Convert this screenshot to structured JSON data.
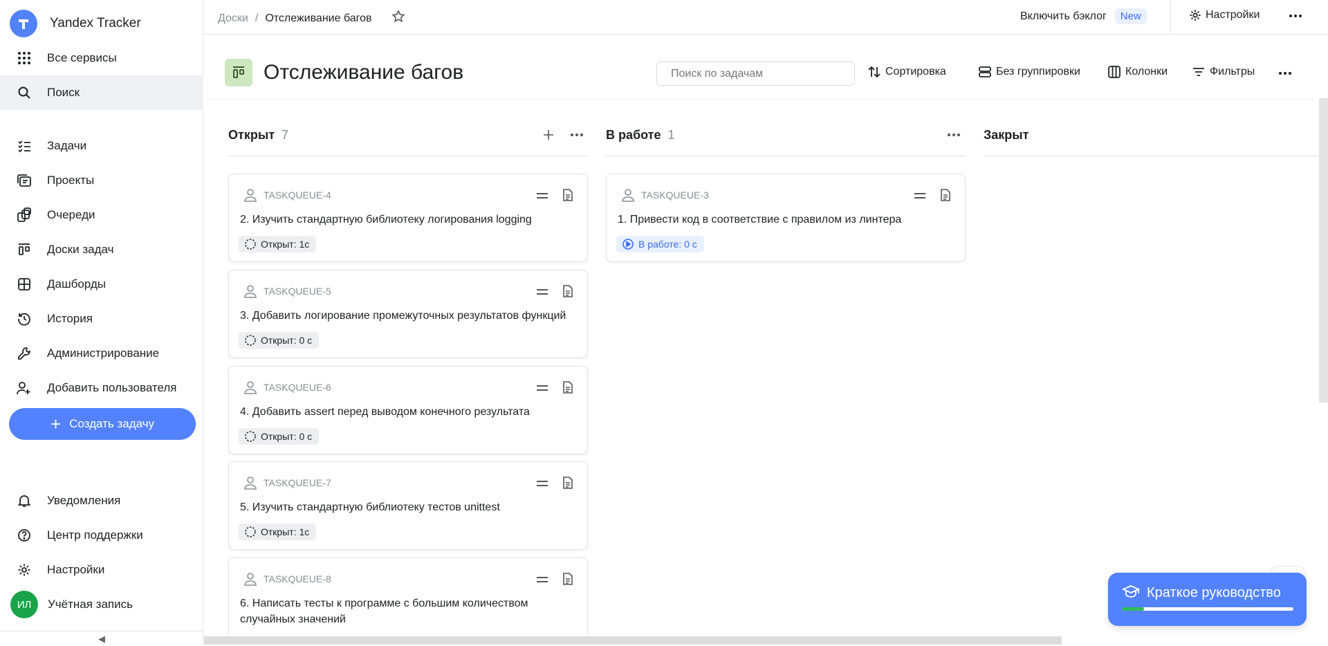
{
  "sidebar": {
    "brand": "Yandex Tracker",
    "items": [
      {
        "label": "Все сервисы",
        "icon": "grid-icon"
      },
      {
        "label": "Поиск",
        "icon": "search-icon"
      },
      {
        "label": "Задачи",
        "icon": "tasks-icon"
      },
      {
        "label": "Проекты",
        "icon": "projects-icon"
      },
      {
        "label": "Очереди",
        "icon": "queues-icon"
      },
      {
        "label": "Доски задач",
        "icon": "boards-icon"
      },
      {
        "label": "Дашборды",
        "icon": "dashboards-icon"
      },
      {
        "label": "История",
        "icon": "history-icon"
      },
      {
        "label": "Администрирование",
        "icon": "wrench-icon"
      },
      {
        "label": "Добавить пользователя",
        "icon": "add-user-icon"
      }
    ],
    "create_button": "Создать задачу",
    "bottom": [
      {
        "label": "Уведомления",
        "icon": "bell-icon"
      },
      {
        "label": "Центр поддержки",
        "icon": "help-icon"
      },
      {
        "label": "Настройки",
        "icon": "gear-icon"
      },
      {
        "label": "Учётная запись",
        "icon": "avatar"
      }
    ],
    "avatar_initials": "ИЛ",
    "collapse_glyph": "◀"
  },
  "topbar": {
    "breadcrumb_root": "Доски",
    "breadcrumb_sep": "/",
    "breadcrumb_current": "Отслеживание багов",
    "backlog_label": "Включить бэклог",
    "backlog_badge": "New",
    "settings_label": "Настройки"
  },
  "board": {
    "title": "Отслеживание багов",
    "search_placeholder": "Поиск по задачам",
    "sort_label": "Сортировка",
    "group_label": "Без группировки",
    "columns_label": "Колонки",
    "filters_label": "Фильтры"
  },
  "columns": [
    {
      "title": "Открыт",
      "count": "7"
    },
    {
      "title": "В работе",
      "count": "1"
    },
    {
      "title": "Закрыт",
      "count": ""
    }
  ],
  "cards_open": [
    {
      "key": "TASKQUEUE-4",
      "title": "2. Изучить стандартную библиотеку логирования logging",
      "status": "Открыт: 1с"
    },
    {
      "key": "TASKQUEUE-5",
      "title": "3. Добавить логирование промежуточных результатов функций",
      "status": "Открыт: 0 с"
    },
    {
      "key": "TASKQUEUE-6",
      "title": "4. Добавить assert перед выводом конечного результата",
      "status": "Открыт: 0 с"
    },
    {
      "key": "TASKQUEUE-7",
      "title": "5. Изучить стандартную библиотеку тестов unittest",
      "status": "Открыт: 1с"
    },
    {
      "key": "TASKQUEUE-8",
      "title": "6. Написать тесты к программе с большим количеством случайных значений",
      "status": ""
    }
  ],
  "cards_work": [
    {
      "key": "TASKQUEUE-3",
      "title": "1. Привести код в соответствие с правилом из линтера",
      "status": "В работе: 0 с"
    }
  ],
  "guide": {
    "label": "Краткое руководство",
    "progress": 0.13
  },
  "colors": {
    "accent": "#5282ff",
    "avatar": "#1aa34a",
    "board_icon": "#cde7bf",
    "progress_fill": "#2ebd59"
  }
}
